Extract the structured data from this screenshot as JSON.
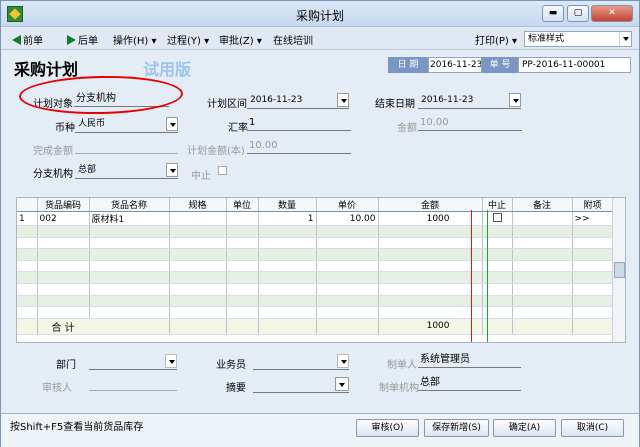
{
  "window": {
    "title": "采购计划",
    "controls": {
      "minimize": "▬",
      "maximize": "▢",
      "close": "✕"
    }
  },
  "toolbar": {
    "prev": "前单",
    "next": "后单",
    "operate": "操作(H)",
    "process": "过程(Y)",
    "approve": "审批(Z)",
    "training": "在线培训",
    "print": "打印(P)",
    "style_value": "标准样式"
  },
  "header": {
    "heading": "采购计划",
    "trial": "试用版",
    "date_label": "日 期",
    "date_value": "2016-11-23",
    "doc_no_label": "单 号",
    "doc_no_value": "PP-2016-11-00001"
  },
  "form": {
    "target_label": "计划对象",
    "target_value": "分支机构",
    "range_label": "计划区间",
    "range_value": "2016-11-23",
    "end_label": "结束日期",
    "end_value": "2016-11-23",
    "currency_label": "币种",
    "currency_value": "人民币",
    "rate_label": "汇率",
    "rate_value": "1",
    "amount_label": "金额",
    "amount_value": "10.00",
    "completed_label": "完成金额",
    "completed_value": "",
    "plan_amount_label": "计划金额(本)",
    "plan_amount_value": "10.00",
    "branch_label": "分支机构",
    "branch_value": "总部",
    "stop_label": "中止"
  },
  "grid": {
    "columns": [
      "",
      "货品编码",
      "货品名称",
      "规格",
      "单位",
      "数量",
      "单价",
      "金额",
      "中止",
      "备注",
      "附项"
    ],
    "rows": [
      {
        "idx": "1",
        "code": "002",
        "name": "原材料1",
        "spec": "",
        "unit": "",
        "qty": "1",
        "price": "10.00",
        "amount": "1000",
        "note": "",
        "extra": ">>"
      }
    ],
    "total_label": "合 计",
    "total_amount": "1000"
  },
  "lower": {
    "dept_label": "部门",
    "sales_label": "业务员",
    "maker_label": "制单人",
    "maker_value": "系统管理员",
    "reviewer_label": "审核人",
    "summary_label": "摘要",
    "maker_org_label": "制单机构",
    "maker_org_value": "总部"
  },
  "status": {
    "tip": "按Shift+F5查看当前货品库存",
    "review": "审核(O)",
    "save_new": "保存新增(S)",
    "ok": "确定(A)",
    "cancel": "取消(C)"
  },
  "annotation": {
    "color": "#e60000"
  }
}
